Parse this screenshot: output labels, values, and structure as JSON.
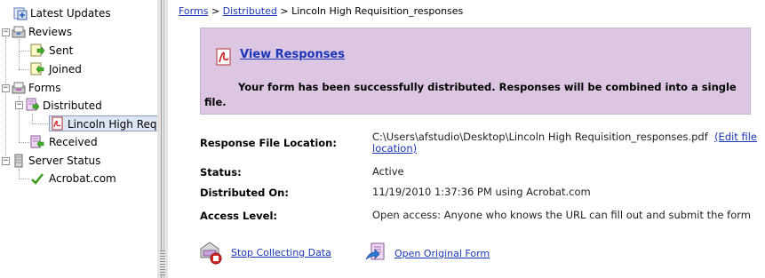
{
  "tree": {
    "items": [
      {
        "label": "Latest Updates",
        "icon": "latest-updates-icon"
      },
      {
        "label": "Reviews",
        "icon": "reviews-folder-icon",
        "expanded": true
      },
      {
        "label": "Sent",
        "icon": "sent-icon"
      },
      {
        "label": "Joined",
        "icon": "joined-icon"
      },
      {
        "label": "Forms",
        "icon": "forms-folder-icon",
        "expanded": true
      },
      {
        "label": "Distributed",
        "icon": "distributed-icon",
        "expanded": true
      },
      {
        "label": "Lincoln High Requis",
        "icon": "pdf-icon",
        "selected": true
      },
      {
        "label": "Received",
        "icon": "received-icon"
      },
      {
        "label": "Server Status",
        "icon": "server-icon",
        "expanded": true
      },
      {
        "label": "Acrobat.com",
        "icon": "checkmark-icon"
      }
    ]
  },
  "breadcrumb": {
    "forms": "Forms",
    "sep1": " > ",
    "distributed": "Distributed",
    "sep2": " > ",
    "current": "Lincoln High Requisition_responses"
  },
  "banner": {
    "link": "View Responses",
    "message": "Your form has been successfully distributed. Responses will be combined into a single file.",
    "color": "#dcc6e2"
  },
  "details": {
    "location_label": "Response File Location:",
    "location_value": "C:\\Users\\afstudio\\Desktop\\Lincoln High Requisition_responses.pdf",
    "edit_link": "(Edit file location)",
    "status_label": "Status:",
    "status_value": "Active",
    "distributed_label": "Distributed On:",
    "distributed_value": "11/19/2010 1:37:36 PM using Acrobat.com",
    "access_label": "Access Level:",
    "access_value": "Open access: Anyone who knows the URL can fill out and submit the form"
  },
  "actions": {
    "stop": "Stop Collecting Data",
    "open": "Open Original Form"
  },
  "colors": {
    "link": "#1a36b8",
    "selection": "#dde6f4"
  }
}
